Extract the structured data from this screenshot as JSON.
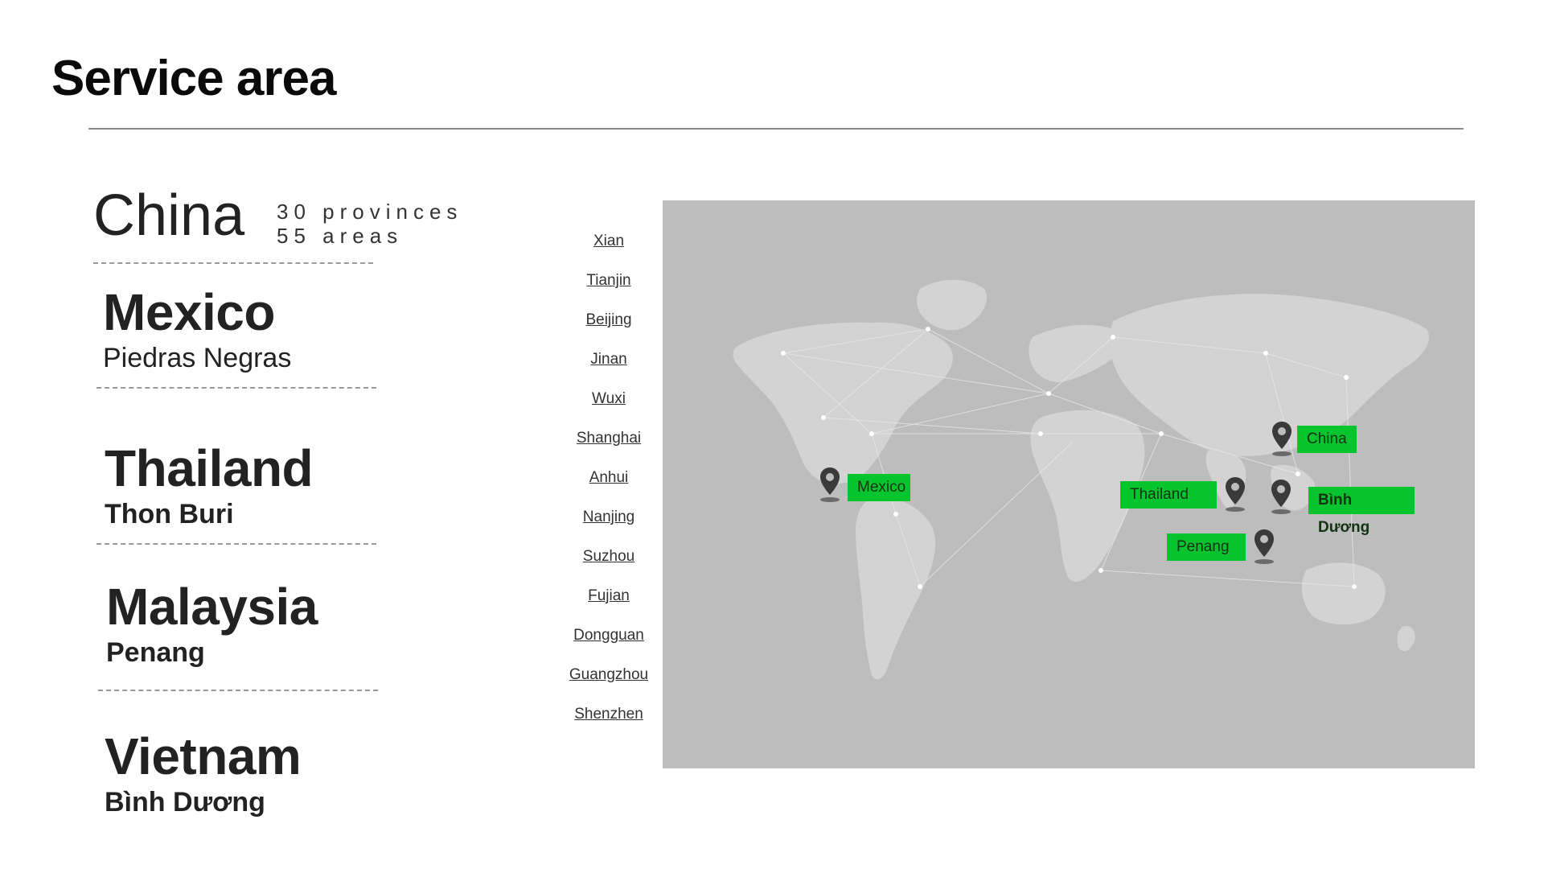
{
  "page": {
    "title": "Service area"
  },
  "china": {
    "name": "China",
    "provinces": "30 provinces",
    "areas": "55 areas"
  },
  "countries": [
    {
      "name": "Mexico",
      "location": "Piedras Negras"
    },
    {
      "name": "Thailand",
      "location": "Thon Buri"
    },
    {
      "name": "Malaysia",
      "location": "Penang"
    },
    {
      "name": "Vietnam",
      "location": "Bình Dương"
    }
  ],
  "cities": [
    "Xian",
    "Tianjin",
    "Beijing",
    "Jinan",
    "Wuxi",
    "Shanghai",
    "Anhui",
    "Nanjing",
    "Suzhou",
    "Fujian",
    "Dongguan",
    "Guangzhou",
    "Shenzhen"
  ],
  "map": {
    "labels": {
      "china": "China",
      "mexico": "Mexico",
      "thailand": "Thailand",
      "vietnam": "Bình Dương",
      "penang": "Penang"
    },
    "colors": {
      "background": "#bdbdbd",
      "land": "#d3d3d3",
      "label": "#06c42d",
      "pin": "#3a3a3a"
    }
  }
}
